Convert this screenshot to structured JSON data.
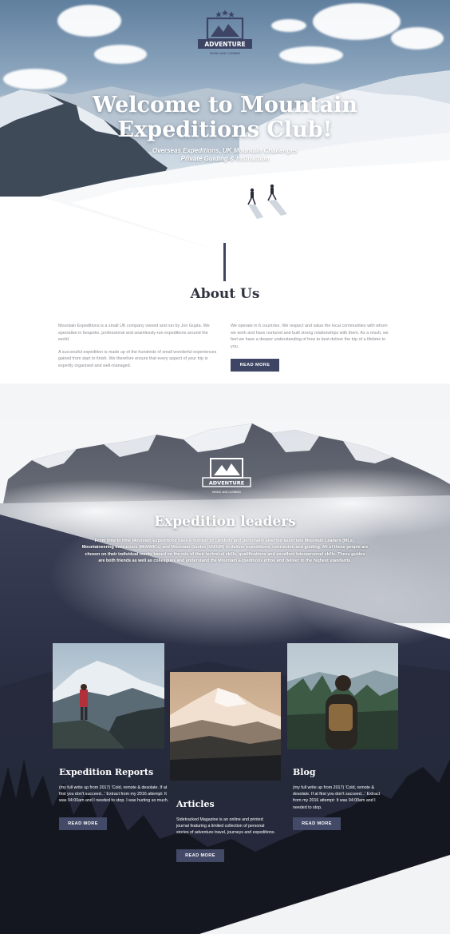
{
  "hero": {
    "logo_text": "ADVENTURE",
    "logo_subtext": "HIKING AND CLIMBING",
    "title_line1": "Welcome to Mountain",
    "title_line2": "Expeditions Club!",
    "subtitle_line1": "Overseas Expeditions, UK Mountain Challenges",
    "subtitle_line2": "Private Guiding & Instruction"
  },
  "about": {
    "title": "About Us",
    "left_p1": "Mountain Expeditions is a small UK company owned and run by Jon Gupta. We specialise in bespoke, professional and seamlessly-run expeditions around the world.",
    "left_p2": "A successful expedition is made up of the hundreds of small wonderful experiences gained from start to finish. We therefore ensure that every aspect of your trip is expertly organised and well-managed.",
    "right_p1": "We operate in 6 countries. We respect and value the local communities with whom we work and have nurtured and built strong relationships with them. As a result, we feel we have a deeper understanding of how to best deliver the trip of a lifetime to you.",
    "button": "READ MORE"
  },
  "leaders": {
    "logo_text": "ADVENTURE",
    "logo_subtext": "HIKING AND CLIMBING",
    "title": "Expedition leaders",
    "text": "From time to time Mountain Expeditions uses a number of carefully and personally selected associate Mountain Leaders (MLs), Mountaineering Instructors (MIA/MICs) and Mountain Guides (UIAGM) to deliver expeditions, instruction and guiding. All of these people are chosen on their individual merits based on the mix of their technical skills, qualifications and excellent interpersonal skills. These guides are both friends as well as colleagues and understand the Mountain Expeditions ethos and deliver to the highest standards."
  },
  "cards": [
    {
      "title": "Expedition Reports",
      "text": "(my full write up from 2017) 'Cold, remote & desolate. If at first you don't succeed...' Extract from my 2016 attempt: It was 04:00am and I needed to stop. I was hurting so much.",
      "button": "READ MORE"
    },
    {
      "title": "Articles",
      "text": "Sidetracked Magazine is an online and printed journal featuring a limited collection of personal stories of adventure travel, journeys and expeditions.",
      "button": "READ MORE"
    },
    {
      "title": "Blog",
      "text": "(my full write up from 2017) 'Cold, remote & desolate. If at first you don't succeed...' Extract from my 2016 attempt: It was 04:00am and I needed to stop.",
      "button": "READ MORE"
    }
  ],
  "colors": {
    "accent": "#3d4464",
    "dark_bg": "#2b2f44",
    "text_muted": "#8a8c93"
  }
}
